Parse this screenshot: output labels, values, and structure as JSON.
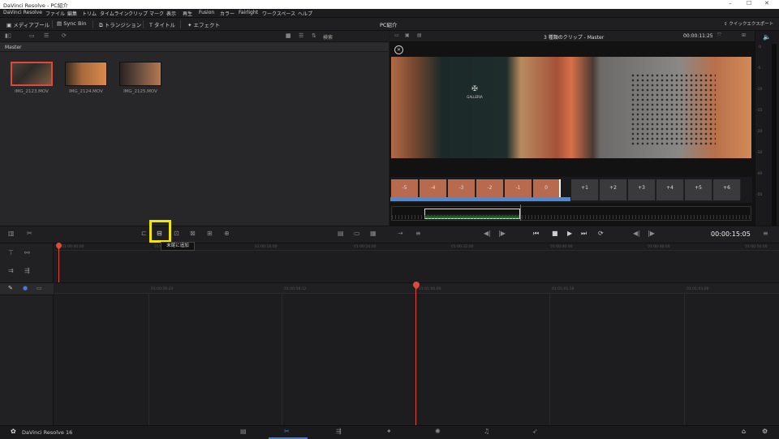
{
  "window": {
    "title": "DaVinci Resolve - PC紹介",
    "minimize": "–",
    "maximize": "☐",
    "close": "✕"
  },
  "menu": [
    "DaVinci Resolve",
    "ファイル",
    "編集",
    "トリム",
    "タイムライン",
    "クリップ",
    "マーク",
    "表示",
    "再生",
    "Fusion",
    "カラー",
    "Fairlight",
    "ワークスペース",
    "ヘルプ"
  ],
  "toolbar": {
    "media_pool": "メディアプール",
    "sync_bin": "Sync Bin",
    "transitions": "トランジション",
    "titles": "タイトル",
    "effects": "エフェクト",
    "project_name": "PC紹介",
    "quick_export": "クイックエクスポート"
  },
  "pool": {
    "search_label": "検索",
    "bin_name": "Master",
    "clips": [
      {
        "name": "IMG_2123.MOV",
        "selected": true
      },
      {
        "name": "IMG_2124.MOV",
        "selected": false
      },
      {
        "name": "IMG_2125.MOV",
        "selected": false
      }
    ]
  },
  "viewer": {
    "title": "3 種類のクリップ - Master",
    "timecode_top": "00:00:11:25",
    "timecode": "00:00:15:05",
    "logo_text": "GALLERIA"
  },
  "filmstrip": [
    "-5",
    "-4",
    "-3",
    "-2",
    "-1",
    "0",
    "+1",
    "+2",
    "+3",
    "+4",
    "+5",
    "+6"
  ],
  "meter_labels": [
    "0",
    "-5",
    "-10",
    "-15",
    "-20",
    "-30",
    "-40",
    "-50"
  ],
  "tooltip": "末尾に追加",
  "timeline": {
    "upper_ticks": [
      "01:00:00:00",
      "01:00:08:00",
      "01:00:16:00",
      "01:00:24:00",
      "01:00:32:00",
      "01:00:40:00",
      "01:00:48:00",
      "01:00:56:00"
    ],
    "lower_ticks": [
      "01:00:56:24",
      "01:00:58:12",
      "01:01:00:00",
      "01:01:01:18",
      "01:01:03:06"
    ]
  },
  "bottom": {
    "app_name": "DaVinci Resolve 16"
  },
  "colors": {
    "accent": "#e0483a",
    "highlight": "#f3e600",
    "panel": "#27272a"
  }
}
